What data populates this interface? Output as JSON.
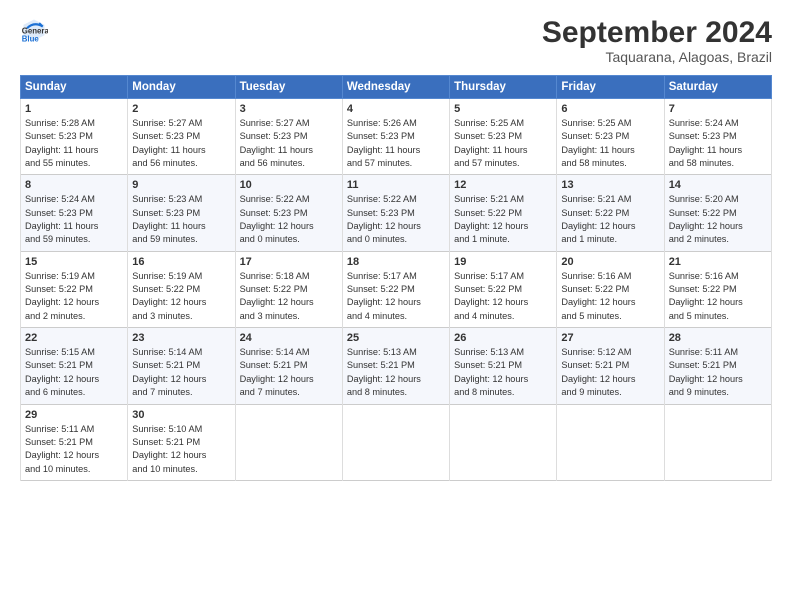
{
  "header": {
    "logo_general": "General",
    "logo_blue": "Blue",
    "month_title": "September 2024",
    "location": "Taquarana, Alagoas, Brazil"
  },
  "weekdays": [
    "Sunday",
    "Monday",
    "Tuesday",
    "Wednesday",
    "Thursday",
    "Friday",
    "Saturday"
  ],
  "weeks": [
    [
      {
        "day": "1",
        "info": "Sunrise: 5:28 AM\nSunset: 5:23 PM\nDaylight: 11 hours\nand 55 minutes."
      },
      {
        "day": "2",
        "info": "Sunrise: 5:27 AM\nSunset: 5:23 PM\nDaylight: 11 hours\nand 56 minutes."
      },
      {
        "day": "3",
        "info": "Sunrise: 5:27 AM\nSunset: 5:23 PM\nDaylight: 11 hours\nand 56 minutes."
      },
      {
        "day": "4",
        "info": "Sunrise: 5:26 AM\nSunset: 5:23 PM\nDaylight: 11 hours\nand 57 minutes."
      },
      {
        "day": "5",
        "info": "Sunrise: 5:25 AM\nSunset: 5:23 PM\nDaylight: 11 hours\nand 57 minutes."
      },
      {
        "day": "6",
        "info": "Sunrise: 5:25 AM\nSunset: 5:23 PM\nDaylight: 11 hours\nand 58 minutes."
      },
      {
        "day": "7",
        "info": "Sunrise: 5:24 AM\nSunset: 5:23 PM\nDaylight: 11 hours\nand 58 minutes."
      }
    ],
    [
      {
        "day": "8",
        "info": "Sunrise: 5:24 AM\nSunset: 5:23 PM\nDaylight: 11 hours\nand 59 minutes."
      },
      {
        "day": "9",
        "info": "Sunrise: 5:23 AM\nSunset: 5:23 PM\nDaylight: 11 hours\nand 59 minutes."
      },
      {
        "day": "10",
        "info": "Sunrise: 5:22 AM\nSunset: 5:23 PM\nDaylight: 12 hours\nand 0 minutes."
      },
      {
        "day": "11",
        "info": "Sunrise: 5:22 AM\nSunset: 5:23 PM\nDaylight: 12 hours\nand 0 minutes."
      },
      {
        "day": "12",
        "info": "Sunrise: 5:21 AM\nSunset: 5:22 PM\nDaylight: 12 hours\nand 1 minute."
      },
      {
        "day": "13",
        "info": "Sunrise: 5:21 AM\nSunset: 5:22 PM\nDaylight: 12 hours\nand 1 minute."
      },
      {
        "day": "14",
        "info": "Sunrise: 5:20 AM\nSunset: 5:22 PM\nDaylight: 12 hours\nand 2 minutes."
      }
    ],
    [
      {
        "day": "15",
        "info": "Sunrise: 5:19 AM\nSunset: 5:22 PM\nDaylight: 12 hours\nand 2 minutes."
      },
      {
        "day": "16",
        "info": "Sunrise: 5:19 AM\nSunset: 5:22 PM\nDaylight: 12 hours\nand 3 minutes."
      },
      {
        "day": "17",
        "info": "Sunrise: 5:18 AM\nSunset: 5:22 PM\nDaylight: 12 hours\nand 3 minutes."
      },
      {
        "day": "18",
        "info": "Sunrise: 5:17 AM\nSunset: 5:22 PM\nDaylight: 12 hours\nand 4 minutes."
      },
      {
        "day": "19",
        "info": "Sunrise: 5:17 AM\nSunset: 5:22 PM\nDaylight: 12 hours\nand 4 minutes."
      },
      {
        "day": "20",
        "info": "Sunrise: 5:16 AM\nSunset: 5:22 PM\nDaylight: 12 hours\nand 5 minutes."
      },
      {
        "day": "21",
        "info": "Sunrise: 5:16 AM\nSunset: 5:22 PM\nDaylight: 12 hours\nand 5 minutes."
      }
    ],
    [
      {
        "day": "22",
        "info": "Sunrise: 5:15 AM\nSunset: 5:21 PM\nDaylight: 12 hours\nand 6 minutes."
      },
      {
        "day": "23",
        "info": "Sunrise: 5:14 AM\nSunset: 5:21 PM\nDaylight: 12 hours\nand 7 minutes."
      },
      {
        "day": "24",
        "info": "Sunrise: 5:14 AM\nSunset: 5:21 PM\nDaylight: 12 hours\nand 7 minutes."
      },
      {
        "day": "25",
        "info": "Sunrise: 5:13 AM\nSunset: 5:21 PM\nDaylight: 12 hours\nand 8 minutes."
      },
      {
        "day": "26",
        "info": "Sunrise: 5:13 AM\nSunset: 5:21 PM\nDaylight: 12 hours\nand 8 minutes."
      },
      {
        "day": "27",
        "info": "Sunrise: 5:12 AM\nSunset: 5:21 PM\nDaylight: 12 hours\nand 9 minutes."
      },
      {
        "day": "28",
        "info": "Sunrise: 5:11 AM\nSunset: 5:21 PM\nDaylight: 12 hours\nand 9 minutes."
      }
    ],
    [
      {
        "day": "29",
        "info": "Sunrise: 5:11 AM\nSunset: 5:21 PM\nDaylight: 12 hours\nand 10 minutes."
      },
      {
        "day": "30",
        "info": "Sunrise: 5:10 AM\nSunset: 5:21 PM\nDaylight: 12 hours\nand 10 minutes."
      },
      {
        "day": "",
        "info": ""
      },
      {
        "day": "",
        "info": ""
      },
      {
        "day": "",
        "info": ""
      },
      {
        "day": "",
        "info": ""
      },
      {
        "day": "",
        "info": ""
      }
    ]
  ]
}
